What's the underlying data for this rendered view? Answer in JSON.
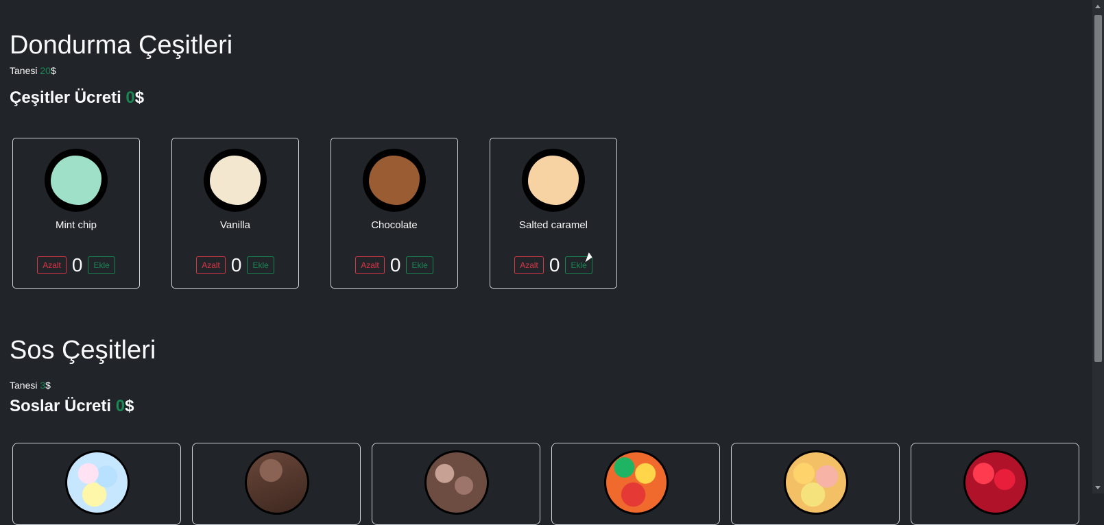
{
  "icecream": {
    "title": "Dondurma Çeşitleri",
    "unit_prefix": "Tanesi ",
    "unit_price": "20",
    "currency": "$",
    "total_label": "Çeşitler Ücreti ",
    "total_value": "0",
    "items": [
      {
        "name": "Mint chip",
        "count": "0",
        "color": "#9ee0c8"
      },
      {
        "name": "Vanilla",
        "count": "0",
        "color": "#f3e7cf"
      },
      {
        "name": "Chocolate",
        "count": "0",
        "color": "#9a5c32"
      },
      {
        "name": "Salted caramel",
        "count": "0",
        "color": "#f7d3a4"
      }
    ],
    "decrease_label": "Azalt",
    "increase_label": "Ekle"
  },
  "sauces": {
    "title": "Sos Çeşitleri",
    "unit_prefix": "Tanesi ",
    "unit_price": "3",
    "currency": "$",
    "total_label": "Soslar Ücreti ",
    "total_value": "0",
    "items": [
      {
        "icon": "candy-icon",
        "color": "#c6e7ff"
      },
      {
        "icon": "chocolate-sauce-icon",
        "color": "#5a3a2f"
      },
      {
        "icon": "chocolate-chips-icon",
        "color": "#7b5a4e"
      },
      {
        "icon": "gummy-bears-icon",
        "color": "#e63f2c"
      },
      {
        "icon": "jelly-candy-icon",
        "color": "#f4c066"
      },
      {
        "icon": "cherry-icon",
        "color": "#c61a2a"
      }
    ]
  },
  "colors": {
    "background": "#212529",
    "accent_green": "#198754",
    "accent_red": "#dc3545"
  }
}
